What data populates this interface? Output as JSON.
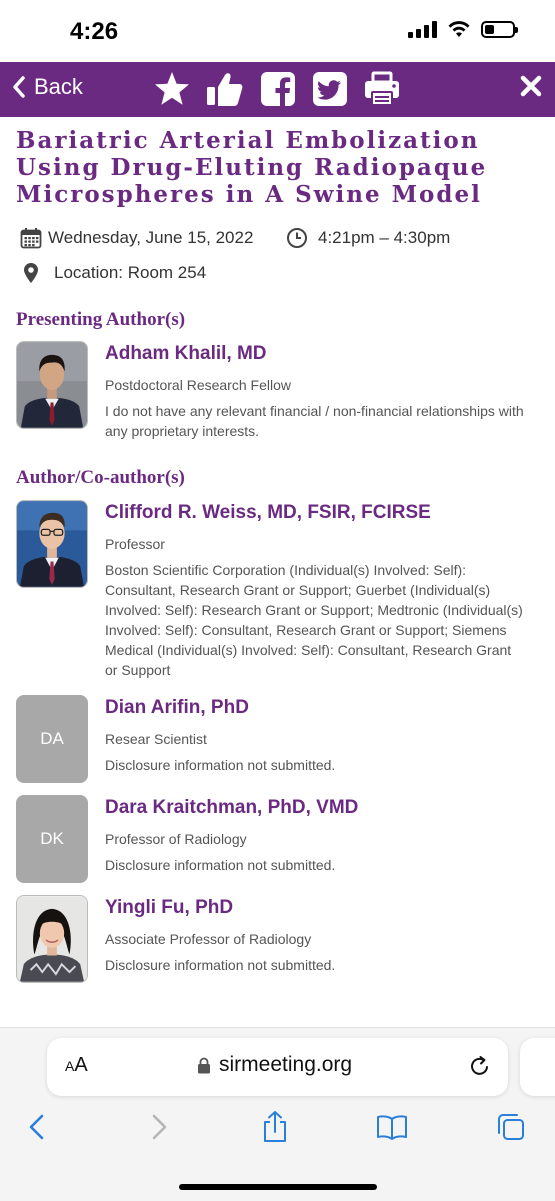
{
  "status_bar": {
    "time": "4:26"
  },
  "toolbar": {
    "back_label": "Back",
    "accent_color": "#6b2a82",
    "icons": [
      "star-icon",
      "thumbs-up-icon",
      "facebook-icon",
      "twitter-icon",
      "print-icon",
      "close-icon"
    ]
  },
  "session": {
    "title_lines": [
      "Bariatric Arterial Embolization",
      "Using Drug-Eluting Radiopaque",
      "Microspheres in A Swine Model"
    ],
    "date": "Wednesday, June 15, 2022",
    "time": "4:21pm – 4:30pm",
    "location": "Location: Room 254"
  },
  "presenting": {
    "heading": "Presenting Author(s)",
    "people": [
      {
        "name": "Adham Khalil, MD",
        "role": "Postdoctoral Research Fellow",
        "disclosure": "I do not have any relevant financial / non-financial relationships with any proprietary interests."
      }
    ]
  },
  "coauthors": {
    "heading": "Author/Co-author(s)",
    "people": [
      {
        "name": "Clifford R. Weiss, MD, FSIR, FCIRSE",
        "role": "Professor",
        "disclosure": "Boston Scientific Corporation (Individual(s) Involved: Self): Consultant, Research Grant or Support; Guerbet (Individual(s) Involved: Self): Research Grant or Support; Medtronic (Individual(s) Involved: Self): Consultant, Research Grant or Support; Siemens Medical (Individual(s) Involved: Self): Consultant, Research Grant or Support"
      },
      {
        "initials": "DA",
        "name": "Dian Arifin, PhD",
        "role": "Resear Scientist",
        "disclosure": "Disclosure information not submitted."
      },
      {
        "initials": "DK",
        "name": "Dara Kraitchman, PhD, VMD",
        "role": "Professor of Radiology",
        "disclosure": "Disclosure information not submitted."
      },
      {
        "name": "Yingli Fu, PhD",
        "role": "Associate Professor of Radiology",
        "disclosure": "Disclosure information not submitted."
      }
    ]
  },
  "browser": {
    "aa_small": "A",
    "aa_large": "A",
    "url": "sirmeeting.org"
  }
}
